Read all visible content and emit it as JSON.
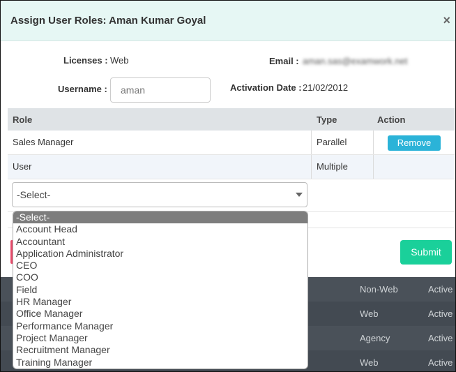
{
  "dialog": {
    "title": "Assign User Roles: Aman Kumar Goyal",
    "close_label": "×"
  },
  "info": {
    "licenses_label": "Licenses :",
    "licenses_value": "Web",
    "email_label": "Email :",
    "email_value": "aman.sas@examwork.net",
    "username_label": "Username :",
    "username_placeholder": "aman",
    "activation_label": "Activation Date :",
    "activation_value": "21/02/2012"
  },
  "table": {
    "headers": {
      "role": "Role",
      "type": "Type",
      "action": "Action"
    },
    "rows": [
      {
        "role": "Sales Manager",
        "type": "Parallel",
        "action": "Remove"
      },
      {
        "role": "User",
        "type": "Multiple",
        "action": ""
      }
    ]
  },
  "role_select": {
    "selected": "-Select-",
    "options": [
      "-Select-",
      "Account Head",
      "Accountant",
      "Application Administrator",
      "CEO",
      "COO",
      "Field",
      "HR Manager",
      "Office Manager",
      "Performance Manager",
      "Project Manager",
      "Recruitment Manager",
      "Training Manager"
    ]
  },
  "footer": {
    "submit_label": "Submit"
  },
  "background_table": {
    "rows": [
      {
        "license": "Non-Web",
        "status": "Active"
      },
      {
        "license": "Web",
        "status": "Active"
      },
      {
        "license": "Agency",
        "status": "Active"
      },
      {
        "license": "Web",
        "status": "Active"
      }
    ]
  }
}
